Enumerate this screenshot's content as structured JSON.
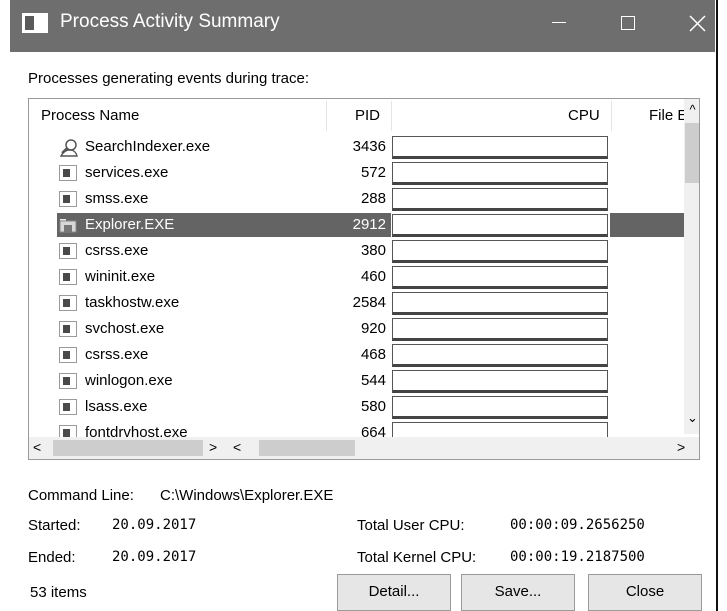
{
  "window": {
    "title": "Process Activity Summary",
    "minimize": "—",
    "maximize": "☐",
    "close": "✕"
  },
  "subtitle": "Processes generating events during trace:",
  "columns": {
    "name": "Process Name",
    "pid": "PID",
    "cpu": "CPU",
    "file": "File E"
  },
  "rows": [
    {
      "name": "SearchIndexer.exe",
      "pid": "3436",
      "icon": "search-person-icon"
    },
    {
      "name": "services.exe",
      "pid": "572",
      "icon": "process-icon"
    },
    {
      "name": "smss.exe",
      "pid": "288",
      "icon": "process-icon"
    },
    {
      "name": "Explorer.EXE",
      "pid": "2912",
      "icon": "folder-icon",
      "selected": true
    },
    {
      "name": "csrss.exe",
      "pid": "380",
      "icon": "process-icon"
    },
    {
      "name": "wininit.exe",
      "pid": "460",
      "icon": "process-icon"
    },
    {
      "name": "taskhostw.exe",
      "pid": "2584",
      "icon": "process-icon"
    },
    {
      "name": "svchost.exe",
      "pid": "920",
      "icon": "process-icon"
    },
    {
      "name": "csrss.exe",
      "pid": "468",
      "icon": "process-icon"
    },
    {
      "name": "winlogon.exe",
      "pid": "544",
      "icon": "process-icon"
    },
    {
      "name": "lsass.exe",
      "pid": "580",
      "icon": "process-icon"
    },
    {
      "name": "fontdrvhost.exe",
      "pid": "664",
      "icon": "process-icon"
    }
  ],
  "details": {
    "command_line_label": "Command Line:",
    "command_line": "C:\\Windows\\Explorer.EXE",
    "started_label": "Started:",
    "started": "20.09.2017",
    "ended_label": "Ended:",
    "ended": "20.09.2017",
    "total_user_cpu_label": "Total User CPU:",
    "total_user_cpu": "00:00:09.2656250",
    "total_kernel_cpu_label": "Total Kernel CPU:",
    "total_kernel_cpu": "00:00:19.2187500"
  },
  "status": {
    "items": "53 items"
  },
  "buttons": {
    "detail": "Detail...",
    "save": "Save...",
    "close": "Close"
  }
}
